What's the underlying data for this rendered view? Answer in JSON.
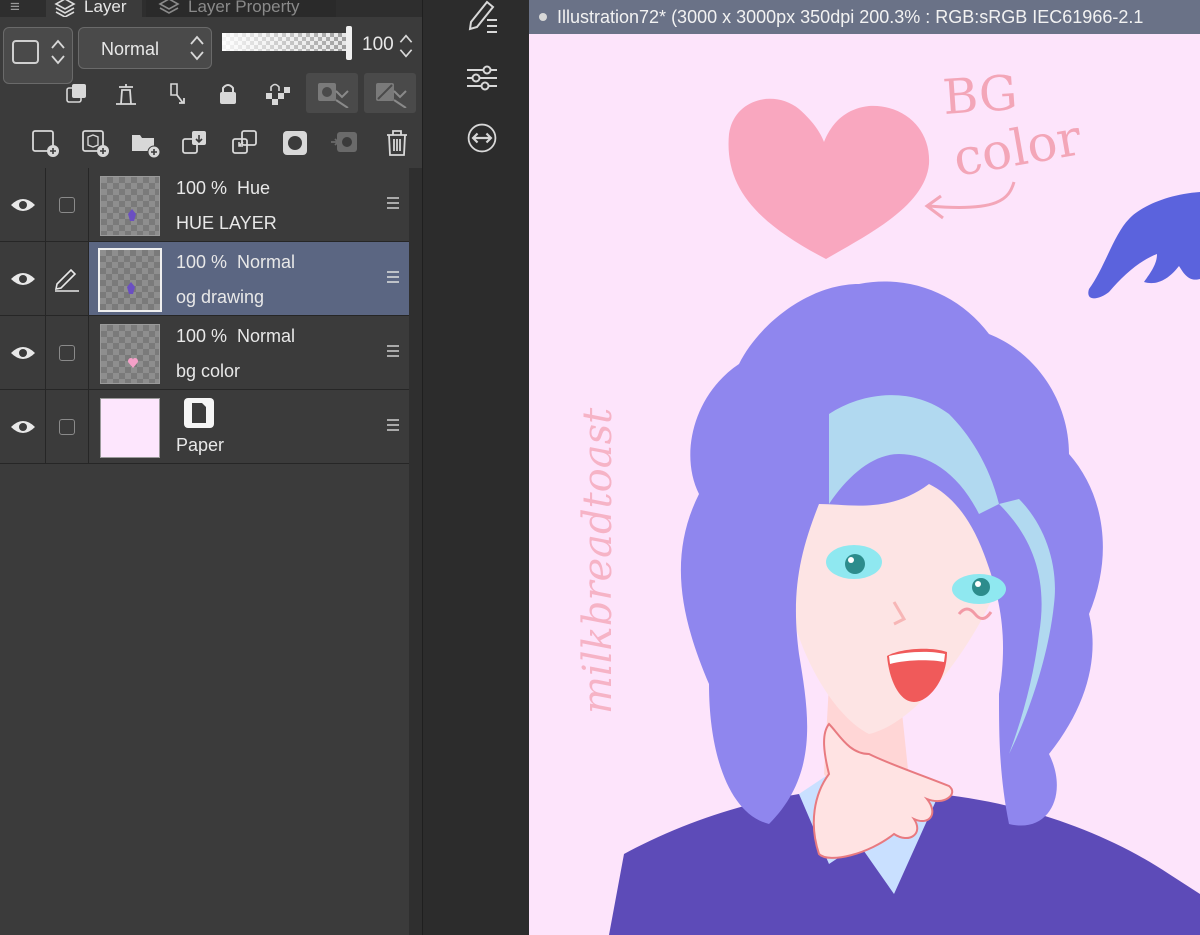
{
  "panel": {
    "tabs": {
      "menu_glyph": "≡",
      "layer": "Layer",
      "layer_property": "Layer Property"
    },
    "blend_mode": "Normal",
    "opacity": "100",
    "prop_icons": [
      "reference-layer-icon",
      "lighthouse-icon",
      "clip-icon",
      "lock-icon",
      "transparency-lock-icon",
      "mask-toggle-icon",
      "ruler-toggle-icon"
    ],
    "action_icons": [
      "new-raster-layer-icon",
      "new-vector-layer-icon",
      "new-folder-icon",
      "transfer-down-icon",
      "merge-down-icon",
      "layer-mask-icon",
      "mask-apply-icon",
      "trash-icon"
    ]
  },
  "layers": [
    {
      "meta": "100 %  Hue",
      "name": "HUE LAYER",
      "selected": false,
      "editing": false,
      "mark_color": "#6b4fc2"
    },
    {
      "meta": "100 %  Normal",
      "name": "og drawing",
      "selected": true,
      "editing": true,
      "mark_color": "#6b4fc2"
    },
    {
      "meta": "100 %  Normal",
      "name": "bg color",
      "selected": false,
      "editing": false,
      "mark_color": "#f5a0c8"
    },
    {
      "meta": "",
      "name": "Paper",
      "selected": false,
      "editing": false,
      "paper": true
    }
  ],
  "canvas": {
    "title": "Illustration72* (3000 x 3000px 350dpi 200.3% : RGB:sRGB IEC61966-2.1",
    "note_line1": "BG",
    "note_line2": "color",
    "signature": "milkbreadtoast",
    "bg_color": "#fde4fb",
    "heart_color": "#f9a7bf",
    "dolphin_color": "#5b63dd",
    "hair_color": "#8f86ee"
  },
  "colors": {
    "panel_bg": "#3b3b3b",
    "selected_row": "#5b6682",
    "title_bar": "#6a7287"
  }
}
